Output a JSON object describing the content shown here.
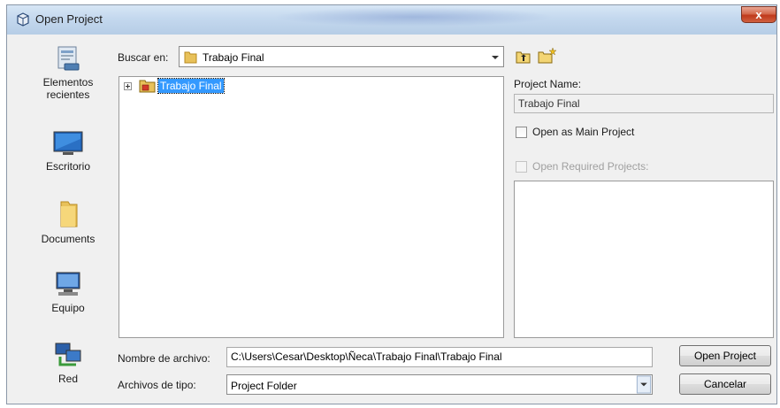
{
  "window": {
    "title": "Open Project",
    "close_label": "x"
  },
  "places": [
    {
      "label_line1": "Elementos",
      "label_line2": "recientes",
      "icon": "recent-items-icon"
    },
    {
      "label_line1": "Escritorio",
      "label_line2": "",
      "icon": "desktop-icon"
    },
    {
      "label_line1": "Documents",
      "label_line2": "",
      "icon": "documents-folder-icon"
    },
    {
      "label_line1": "Equipo",
      "label_line2": "",
      "icon": "computer-icon"
    },
    {
      "label_line1": "Red",
      "label_line2": "",
      "icon": "network-icon"
    }
  ],
  "look_in": {
    "label": "Buscar en:",
    "value": "Trabajo Final"
  },
  "tree": {
    "items": [
      {
        "label": "Trabajo Final",
        "selected": true
      }
    ]
  },
  "project_name": {
    "label": "Project Name:",
    "value": "Trabajo Final"
  },
  "open_main": {
    "label": "Open as Main Project",
    "checked": false
  },
  "open_required": {
    "label": "Open Required Projects:",
    "checked": false,
    "enabled": false
  },
  "file_name": {
    "label": "Nombre de archivo:",
    "value": "C:\\Users\\Cesar\\Desktop\\Ñeca\\Trabajo Final\\Trabajo Final"
  },
  "file_type": {
    "label": "Archivos de tipo:",
    "value": "Project Folder"
  },
  "buttons": {
    "open": "Open Project",
    "cancel": "Cancelar"
  },
  "colors": {
    "selection": "#3399ff",
    "close_button": "#c0391b",
    "window_bg": "#f0f0f0"
  }
}
